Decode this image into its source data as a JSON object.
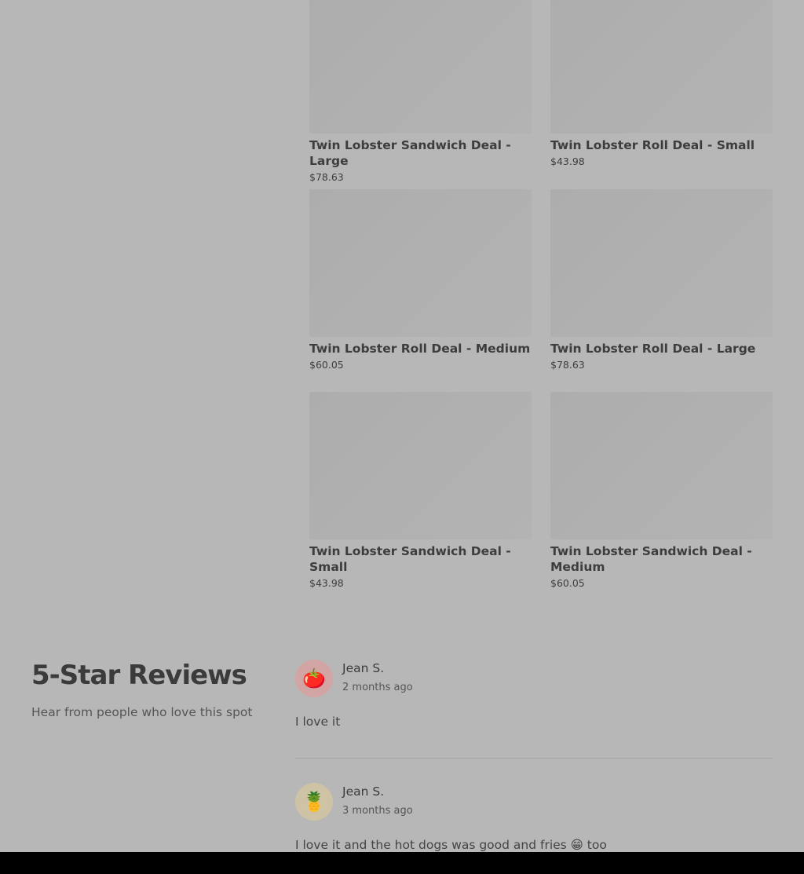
{
  "menu_items": [
    {
      "name": "Twin Lobster Sandwich Deal - Large",
      "price": "$78.63"
    },
    {
      "name": "Twin Lobster Roll Deal - Small",
      "price": "$43.98"
    },
    {
      "name": "Twin Lobster Roll Deal - Medium",
      "price": "$60.05"
    },
    {
      "name": "Twin Lobster Roll Deal - Large",
      "price": "$78.63"
    },
    {
      "name": "Twin Lobster Sandwich Deal - Small",
      "price": "$43.98"
    },
    {
      "name": "Twin Lobster Sandwich Deal - Medium",
      "price": "$60.05"
    }
  ],
  "reviews_section": {
    "title": "5-Star Reviews",
    "subtitle": "Hear from people who love this spot"
  },
  "reviews": [
    {
      "avatar": "🍅",
      "avatar_name": "tomato-icon",
      "avatar_bg": "#d2a4a4",
      "name": "Jean S.",
      "ago": "2 months ago",
      "text": "I love it"
    },
    {
      "avatar": "🍍",
      "avatar_name": "pineapple-icon",
      "avatar_bg": "#cfc3a6",
      "name": "Jean S.",
      "ago": "3 months ago",
      "text": "I love it and the hot dogs was good and fries 😁 too"
    }
  ]
}
